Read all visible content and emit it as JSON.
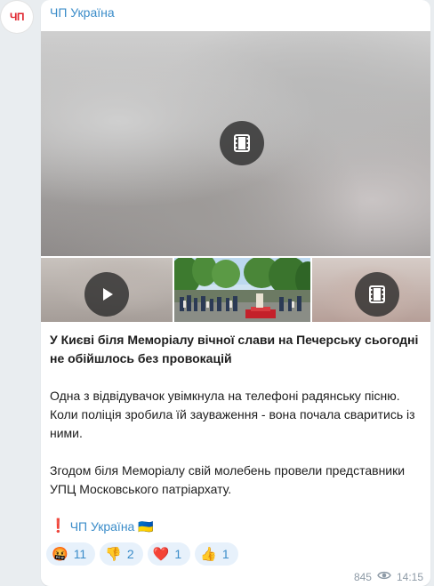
{
  "channel": {
    "name": "ЧП Україна",
    "avatar_text": "ЧП"
  },
  "post": {
    "title": "У Києві біля Меморіалу вічної слави на Печерську сьогодні не обійшлось без провокацій",
    "paragraph_1": "Одна з відвідувачок увімкнула на телефоні радянську пісню. Коли поліція зробила їй зауваження - вона почала сваритись із ними.",
    "paragraph_2": "Згодом біля Меморіалу свій молебень провели представники УПЦ Московського патріархату.",
    "signature_mark": "❗",
    "signature_link": "ЧП Україна",
    "signature_flag": "🇺🇦"
  },
  "media": {
    "main": {
      "type": "video",
      "icon": "film-icon"
    },
    "thumbs": [
      {
        "type": "video",
        "icon": "play-icon"
      },
      {
        "type": "photo"
      },
      {
        "type": "video",
        "icon": "film-icon"
      }
    ]
  },
  "reactions": [
    {
      "emoji": "🤬",
      "count": "11"
    },
    {
      "emoji": "👎",
      "count": "2"
    },
    {
      "emoji": "❤️",
      "count": "1"
    },
    {
      "emoji": "👍",
      "count": "1"
    }
  ],
  "meta": {
    "views": "845",
    "time": "14:15"
  },
  "colors": {
    "accent": "#3a8cc9",
    "reaction_bg": "#e7f1fb",
    "avatar_text": "#e0262f"
  }
}
